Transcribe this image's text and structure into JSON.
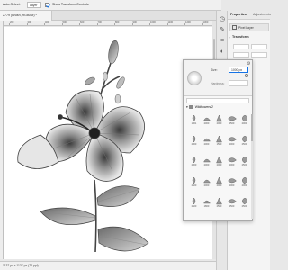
{
  "options_bar": {
    "auto_select_label": "Auto-Select:",
    "auto_select_value": "Layer",
    "show_transform_label": "Show Transform Controls"
  },
  "document": {
    "tab_title": "2779 (Brush, RGB/8#) *"
  },
  "ruler": {
    "ticks": [
      "200",
      "300",
      "400",
      "500",
      "600",
      "700",
      "800",
      "900",
      "1000",
      "1100",
      "1200",
      "1300"
    ]
  },
  "status_bar": {
    "text": "1137 px x 1137 px (72 ppi)"
  },
  "properties_panel": {
    "tabs": [
      "Properties",
      "Adjustments"
    ],
    "layer_label": "Pixel Layer",
    "section_title": "Transform"
  },
  "brush_popup": {
    "size_label": "Size:",
    "size_value": "1000 px",
    "size_fraction": 1.0,
    "hardness_label": "Hardness:",
    "folder_name": "Wildflowers 2",
    "brush_sizes": [
      "1001",
      "2000",
      "2000",
      "2500",
      "2000",
      "2000",
      "2000",
      "1500",
      "2000",
      "2500",
      "2000",
      "2000",
      "2000",
      "2000",
      "2500",
      "2500",
      "2000",
      "2000",
      "2000",
      "2000",
      "2500",
      "1800",
      "2500",
      "2500",
      "2500"
    ]
  },
  "colors": {
    "accent": "#1473e6",
    "panel_bg": "#f4f4f4",
    "canvas_bg": "#ffffff"
  }
}
